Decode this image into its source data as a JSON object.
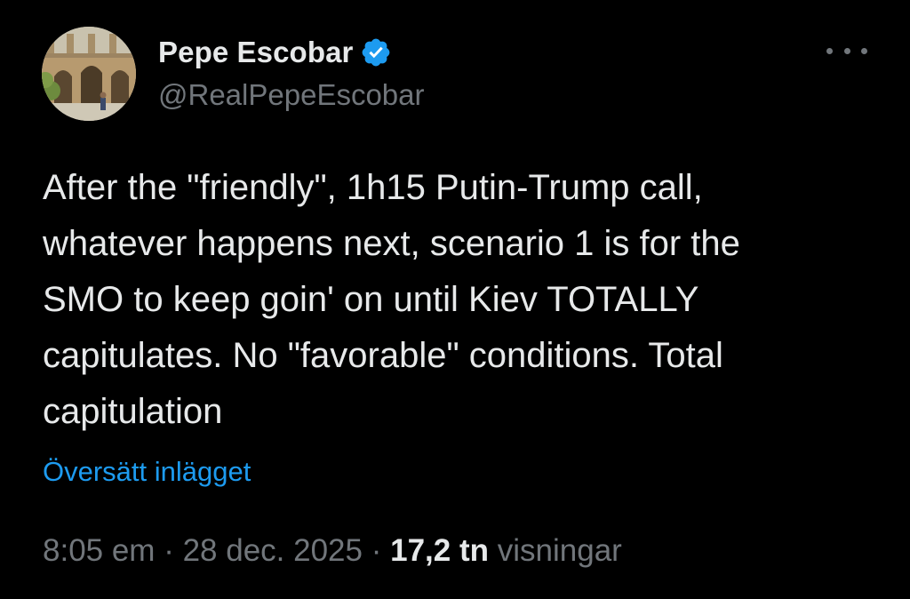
{
  "author": {
    "display_name": "Pepe Escobar",
    "handle": "@RealPepeEscobar",
    "verified": true,
    "verified_color": "#1d9bf0"
  },
  "tweet": {
    "lines": [
      "After the \"friendly\", 1h15 Putin-Trump call,",
      "whatever happens next, scenario 1 is for the",
      "SMO to keep goin' on until Kiev TOTALLY",
      "capitulates. No \"favorable\" conditions. Total",
      "capitulation"
    ],
    "translate_label": "Översätt inlägget"
  },
  "meta": {
    "time": "8:05 em",
    "separator": "·",
    "date": "28 dec. 2025",
    "views_count": "17,2 tn",
    "views_label": "visningar"
  },
  "colors": {
    "background": "#000000",
    "text_primary": "#e7e9ea",
    "text_secondary": "#71767b",
    "accent": "#1d9bf0"
  },
  "icons": {
    "verified": "verified-badge-icon",
    "more": "more-options-icon"
  }
}
